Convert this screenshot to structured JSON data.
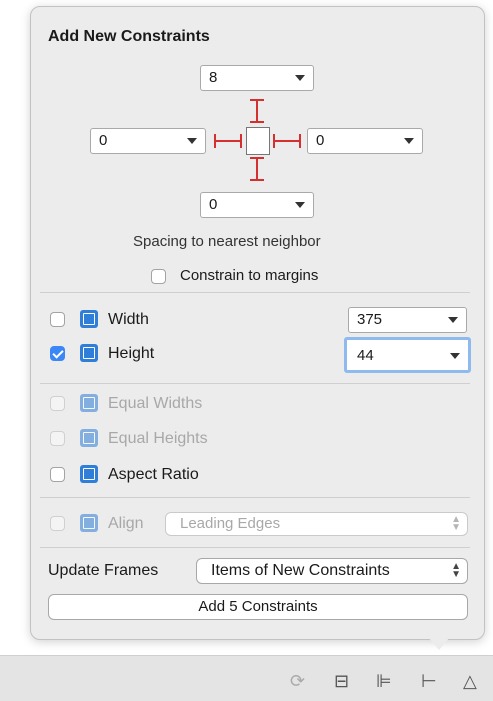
{
  "panel": {
    "title": "Add New Constraints",
    "spacing_caption": "Spacing to nearest neighbor",
    "constrain_margins": {
      "label": "Constrain to margins",
      "checked": false
    }
  },
  "spacing": {
    "top": "8",
    "left": "0",
    "right": "0",
    "bottom": "0"
  },
  "size": {
    "width": {
      "label": "Width",
      "value": "375",
      "checked": false
    },
    "height": {
      "label": "Height",
      "value": "44",
      "checked": true
    }
  },
  "equal": {
    "widths": {
      "label": "Equal Widths",
      "enabled": false
    },
    "heights": {
      "label": "Equal Heights",
      "enabled": false
    },
    "aspect": {
      "label": "Aspect Ratio",
      "enabled": true
    }
  },
  "align": {
    "label": "Align",
    "value": "Leading Edges",
    "enabled": false
  },
  "update_frames": {
    "label": "Update Frames",
    "value": "Items of New Constraints"
  },
  "add_button": {
    "label": "Add 5 Constraints"
  },
  "toolbar": {
    "icons": [
      "refresh-icon",
      "stack-icon",
      "align-icon",
      "pin-icon",
      "resolve-icon"
    ]
  },
  "colors": {
    "accent": "#2f7ed8",
    "constraint_red": "#d43030",
    "focus": "#8fbaf0"
  }
}
